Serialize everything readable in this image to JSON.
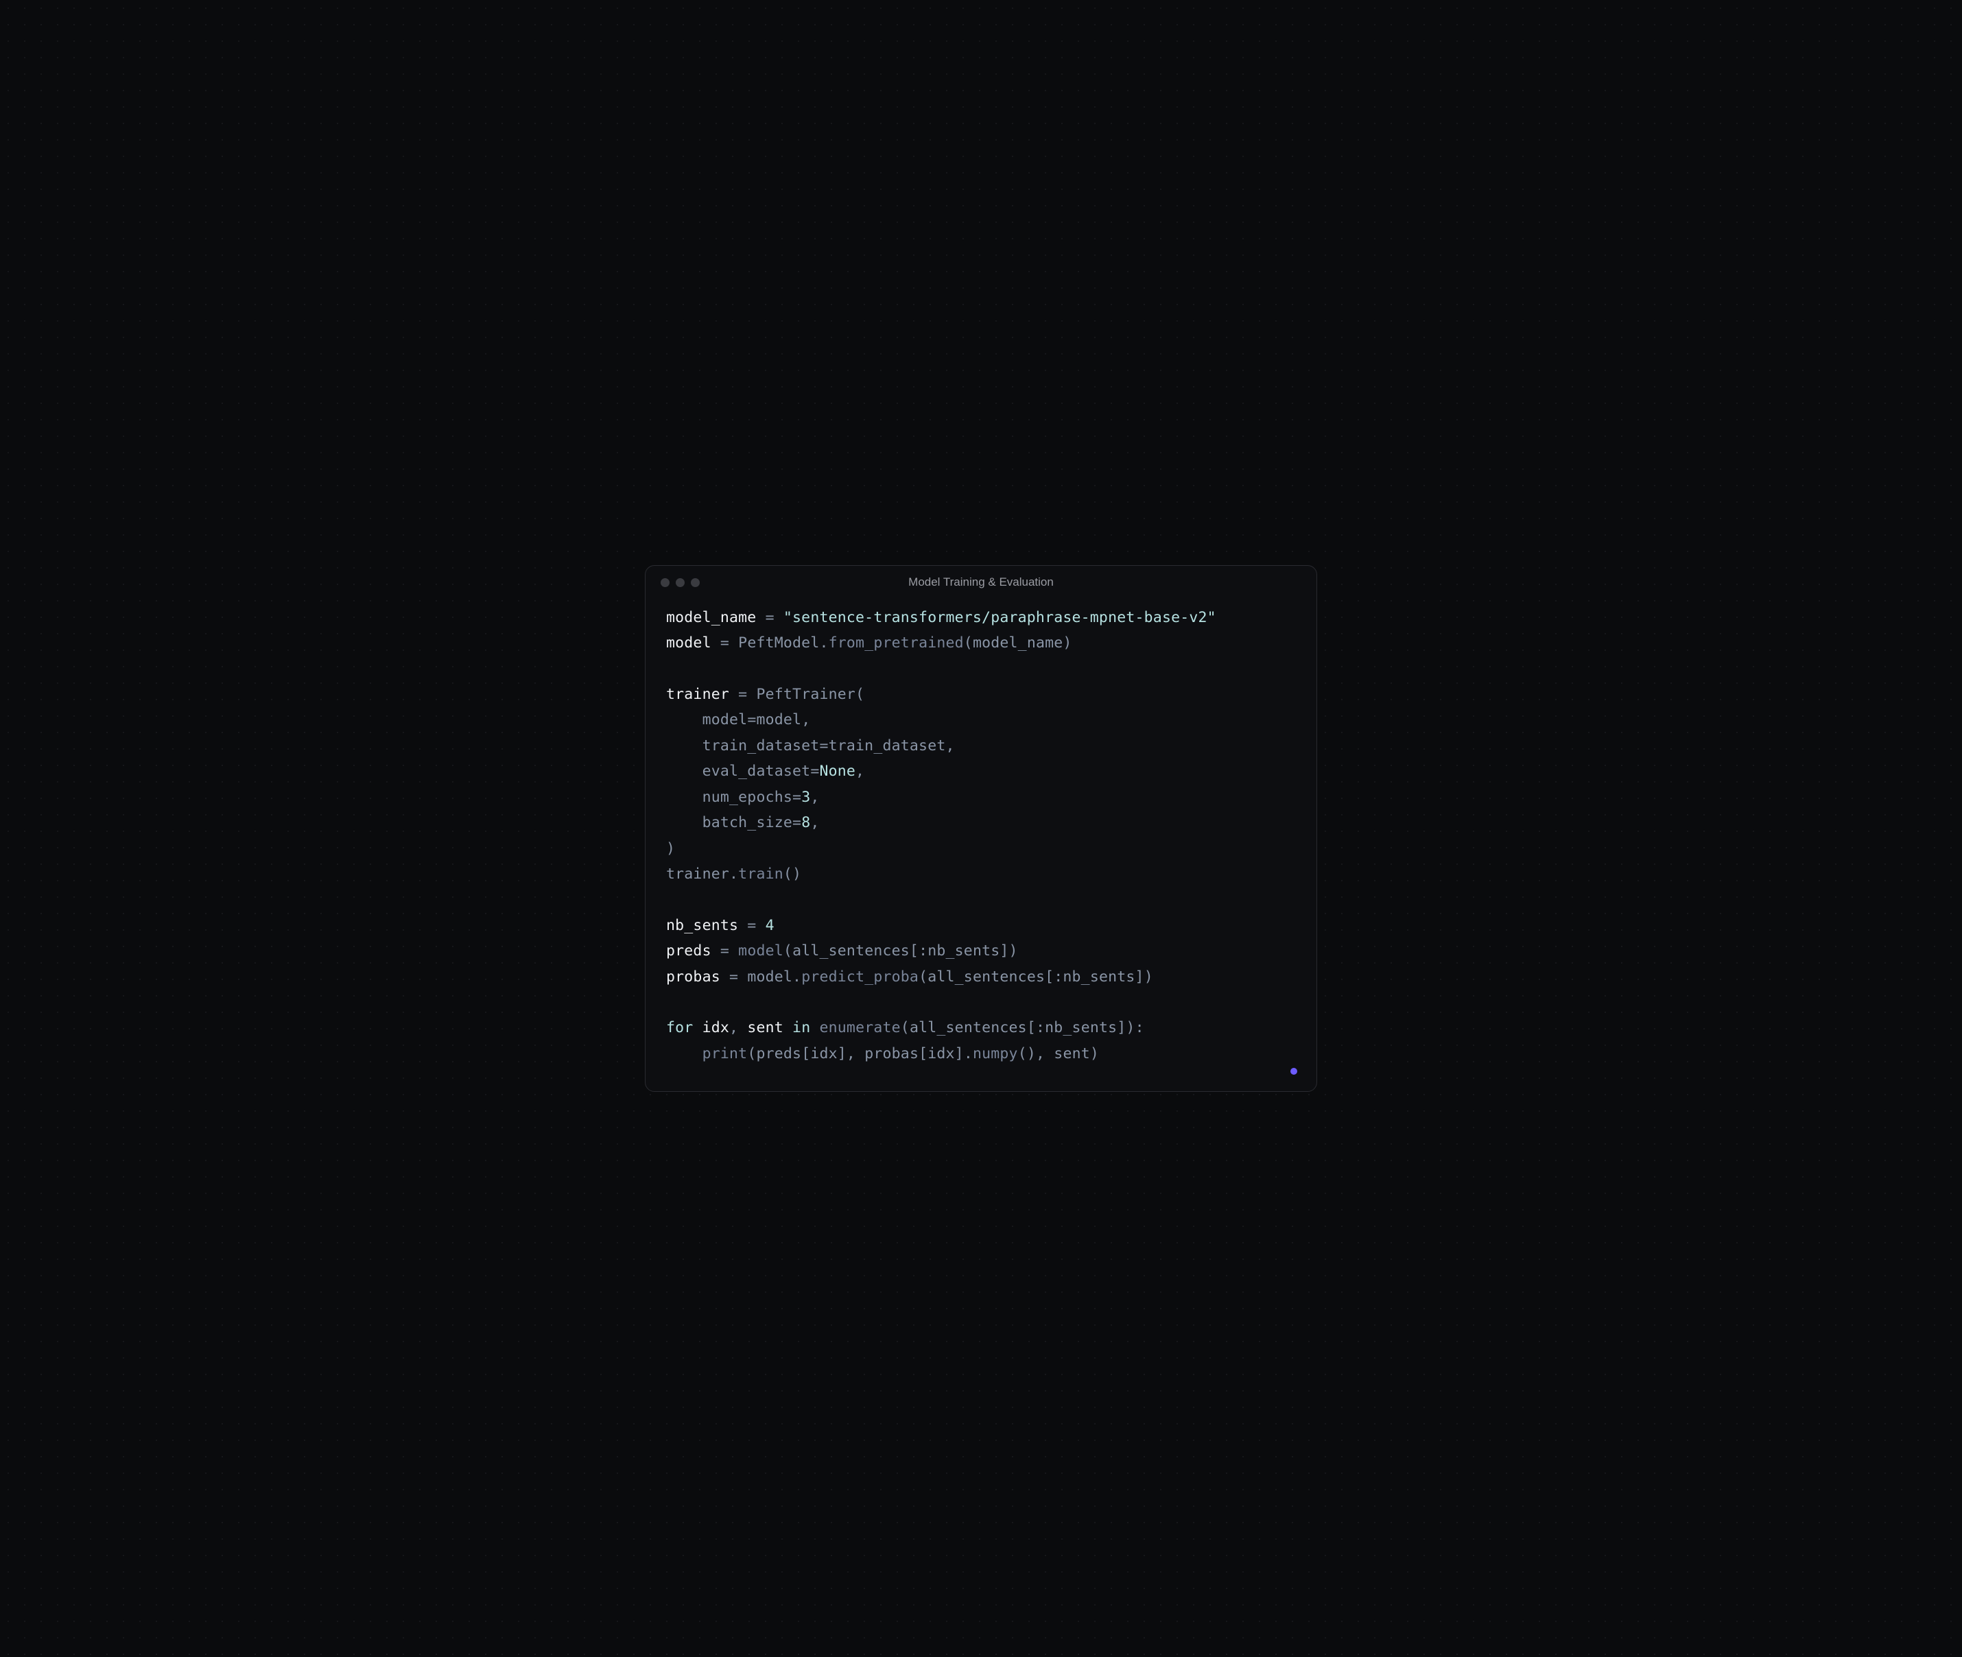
{
  "window": {
    "title": "Model Training & Evaluation"
  },
  "tokens": {
    "l1_var": "model_name",
    "l1_eq": " = ",
    "l1_str": "\"sentence-transformers/paraphrase-mpnet-base-v2\"",
    "l2_var": "model",
    "l2_eq": " = ",
    "l2_cls": "PeftModel",
    "l2_dot": ".",
    "l2_fn": "from_pretrained",
    "l2_op": "(",
    "l2_arg": "model_name",
    "l2_cp": ")",
    "l4_var": "trainer",
    "l4_eq": " = ",
    "l4_cls": "PeftTrainer",
    "l4_op": "(",
    "l5_indent": "    ",
    "l5_k": "model",
    "l5_eq": "=",
    "l5_v": "model",
    "l5_com": ",",
    "l6_k": "train_dataset",
    "l6_eq": "=",
    "l6_v": "train_dataset",
    "l6_com": ",",
    "l7_k": "eval_dataset",
    "l7_eq": "=",
    "l7_v": "None",
    "l7_com": ",",
    "l8_k": "num_epochs",
    "l8_eq": "=",
    "l8_v": "3",
    "l8_com": ",",
    "l9_k": "batch_size",
    "l9_eq": "=",
    "l9_v": "8",
    "l9_com": ",",
    "l10_cp": ")",
    "l11_obj": "trainer",
    "l11_dot": ".",
    "l11_fn": "train",
    "l11_pr": "()",
    "l13_var": "nb_sents",
    "l13_eq": " = ",
    "l13_v": "4",
    "l14_var": "preds",
    "l14_eq": " = ",
    "l14_fn": "model",
    "l14_op": "(",
    "l14_arg": "all_sentences[:nb_sents]",
    "l14_cp": ")",
    "l15_var": "probas",
    "l15_eq": " = ",
    "l15_obj": "model",
    "l15_dot": ".",
    "l15_fn": "predict_proba",
    "l15_op": "(",
    "l15_arg": "all_sentences[:nb_sents]",
    "l15_cp": ")",
    "l17_for": "for",
    "l17_idx": " idx",
    "l17_com": ", ",
    "l17_sent": "sent ",
    "l17_in": "in",
    "l17_sp": " ",
    "l17_enum": "enumerate",
    "l17_op": "(",
    "l17_arg": "all_sentences[:nb_sents]",
    "l17_cp": "):",
    "l18_indent": "    ",
    "l18_print": "print",
    "l18_op": "(",
    "l18_a1": "preds[idx]",
    "l18_c1": ", ",
    "l18_a2": "probas[idx]",
    "l18_dot": ".",
    "l18_np": "numpy",
    "l18_npr": "()",
    "l18_c2": ", ",
    "l18_a3": "sent",
    "l18_cp": ")"
  }
}
